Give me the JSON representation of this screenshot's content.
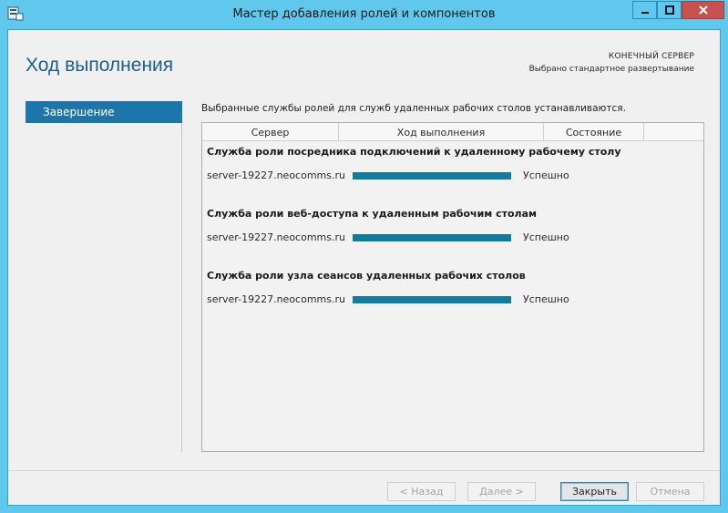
{
  "window": {
    "title": "Мастер добавления ролей и компонентов",
    "colors": {
      "frame": "#5fc8ec",
      "close": "#c75050",
      "accent": "#1c76ab",
      "progress": "#127c9a"
    }
  },
  "header": {
    "page_title": "Ход выполнения",
    "destination_label": "КОНЕЧНЫЙ СЕРВЕР",
    "destination_value": "Выбрано стандартное развертывание"
  },
  "nav": {
    "items": [
      {
        "label": "Завершение",
        "selected": true
      }
    ]
  },
  "main": {
    "status_message": "Выбранные службы ролей для служб удаленных рабочих столов устанавливаются.",
    "columns": [
      "Сервер",
      "Ход выполнения",
      "Состояние"
    ],
    "groups": [
      {
        "title": "Служба роли посредника подключений к удаленному рабочему столу",
        "server": "server-19227.neocomms.ru",
        "progress": 1.0,
        "status": "Успешно"
      },
      {
        "title": "Служба роли веб-доступа к удаленным рабочим столам",
        "server": "server-19227.neocomms.ru",
        "progress": 1.0,
        "status": "Успешно"
      },
      {
        "title": "Служба роли узла сеансов удаленных рабочих столов",
        "server": "server-19227.neocomms.ru",
        "progress": 1.0,
        "status": "Успешно"
      }
    ]
  },
  "footer": {
    "back_label": "< Назад",
    "next_label": "Далее >",
    "close_label": "Закрыть",
    "cancel_label": "Отмена"
  }
}
